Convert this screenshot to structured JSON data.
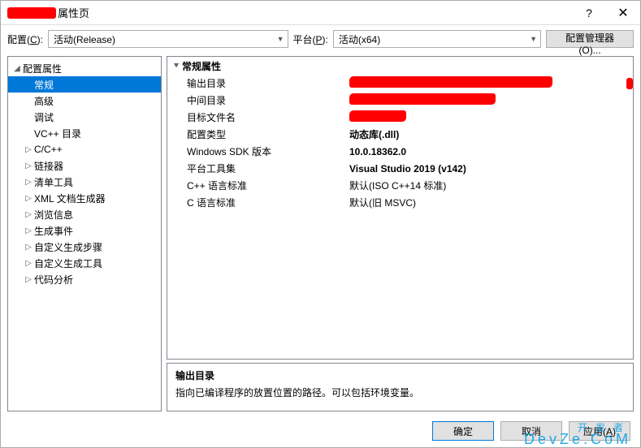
{
  "titlebar": {
    "suffix": "属性页"
  },
  "config_row": {
    "config_label": "配置(C):",
    "config_value": "活动(Release)",
    "platform_label": "平台(P):",
    "platform_value": "活动(x64)",
    "manager_btn": "配置管理器(O)..."
  },
  "tree": {
    "root": "配置属性",
    "items": [
      {
        "label": "常规",
        "selected": true,
        "expandable": false
      },
      {
        "label": "高级",
        "expandable": false
      },
      {
        "label": "调试",
        "expandable": false
      },
      {
        "label": "VC++ 目录",
        "expandable": false
      },
      {
        "label": "C/C++",
        "expandable": true
      },
      {
        "label": "链接器",
        "expandable": true
      },
      {
        "label": "清单工具",
        "expandable": true
      },
      {
        "label": "XML 文档生成器",
        "expandable": true
      },
      {
        "label": "浏览信息",
        "expandable": true
      },
      {
        "label": "生成事件",
        "expandable": true
      },
      {
        "label": "自定义生成步骤",
        "expandable": true
      },
      {
        "label": "自定义生成工具",
        "expandable": true
      },
      {
        "label": "代码分析",
        "expandable": true
      }
    ]
  },
  "props": {
    "section": "常规属性",
    "rows": [
      {
        "label": "输出目录",
        "value": "",
        "redact": "r1",
        "tail": true
      },
      {
        "label": "中间目录",
        "value": "",
        "redact": "r2"
      },
      {
        "label": "目标文件名",
        "value": "",
        "redact": "r3"
      },
      {
        "label": "配置类型",
        "value": "动态库(.dll)",
        "bold": true
      },
      {
        "label": "Windows SDK 版本",
        "value": "10.0.18362.0",
        "bold": true
      },
      {
        "label": "平台工具集",
        "value": "Visual Studio 2019 (v142)",
        "bold": true
      },
      {
        "label": "C++ 语言标准",
        "value": "默认(ISO C++14 标准)"
      },
      {
        "label": "C 语言标准",
        "value": "默认(旧 MSVC)"
      }
    ]
  },
  "desc": {
    "title": "输出目录",
    "text": "指向已编译程序的放置位置的路径。可以包括环境变量。"
  },
  "buttons": {
    "ok": "确定",
    "cancel": "取消",
    "apply": "应用(A)"
  },
  "watermark": {
    "main": "开发者",
    "sub": "DevZe.CoM"
  }
}
